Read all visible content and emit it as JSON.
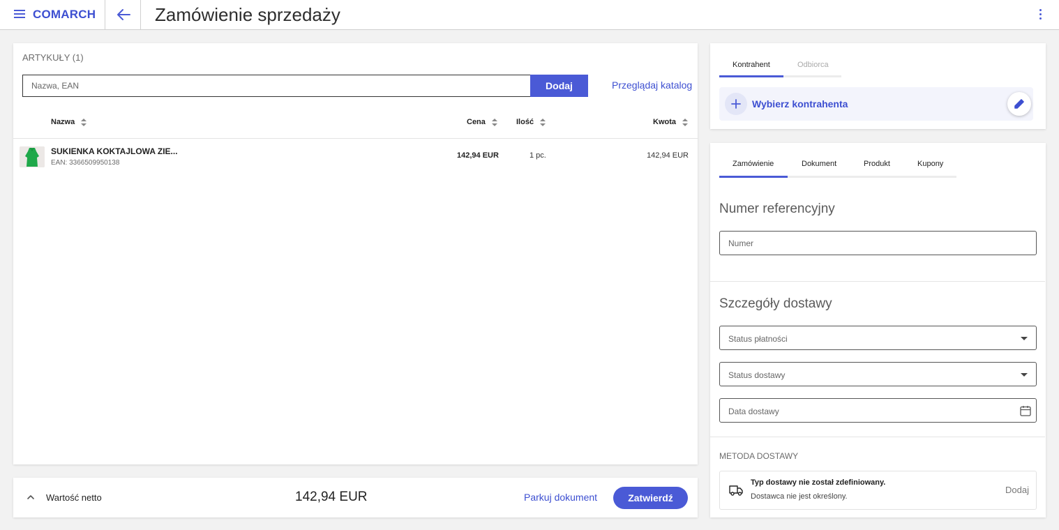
{
  "header": {
    "brand": "COMARCH",
    "title": "Zamówienie sprzedaży",
    "icons": {
      "menu": "hamburger-menu-icon",
      "back": "arrow-left-icon",
      "more": "more-vertical-icon"
    }
  },
  "articles": {
    "title": "ARTYKUŁY (1)",
    "search_placeholder": "Nazwa, EAN",
    "add_label": "Dodaj",
    "catalog_link": "Przeglądaj katalog",
    "columns": [
      "Nazwa",
      "Cena",
      "Ilość",
      "Kwota"
    ],
    "items": [
      {
        "name": "SUKIENKA KOKTAJLOWA ZIE...",
        "ean": "EAN: 3366509950138",
        "price": "142,94 EUR",
        "qty": "1 pc.",
        "amount": "142,94 EUR"
      }
    ]
  },
  "footer": {
    "net_label": "Wartość netto",
    "net_value": "142,94 EUR",
    "park_label": "Parkuj dokument",
    "confirm_label": "Zatwierdź"
  },
  "contractor": {
    "tabs": [
      "Kontrahent",
      "Odbiorca"
    ],
    "active_tab": "Kontrahent",
    "select_label": "Wybierz kontrahenta"
  },
  "order": {
    "tabs": [
      "Zamówienie",
      "Dokument",
      "Produkt",
      "Kupony"
    ],
    "active_tab": "Zamówienie",
    "reference_title": "Numer referencyjny",
    "reference_placeholder": "Numer",
    "delivery_title": "Szczegóły dostawy",
    "payment_status_label": "Status płatności",
    "delivery_status_label": "Status dostawy",
    "delivery_date_label": "Data dostawy",
    "method_title": "METODA DOSTAWY",
    "delivery_type_text": "Typ dostawy nie został zdefiniowany.",
    "delivery_provider_text": "Dostawca nie jest określony.",
    "delivery_add_label": "Dodaj"
  },
  "colors": {
    "accent": "#4a5ad6",
    "brand": "#3d4fd1",
    "background": "#f2f2f2"
  }
}
